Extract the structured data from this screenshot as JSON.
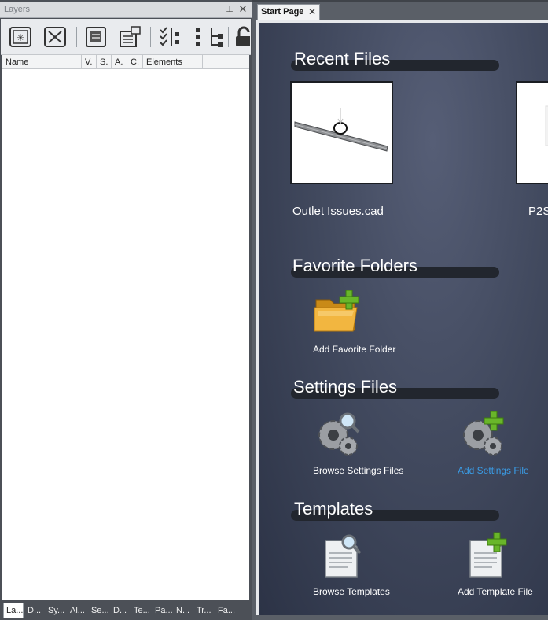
{
  "layers_panel": {
    "title": "Layers",
    "pin_glyph": "⊥",
    "close_glyph": "✕",
    "toolbar_icons": [
      "new-layer-icon",
      "delete-layer-icon",
      "layer-manager-icon",
      "layer-properties-icon",
      "check-tree-icon",
      "expand-tree-icon",
      "collapse-tree-icon",
      "lock-icon"
    ],
    "columns": [
      "Name",
      "V.",
      "S.",
      "A.",
      "C.",
      "Elements"
    ],
    "bottom_tabs": [
      "La...",
      "D...",
      "Sy...",
      "Al...",
      "Se...",
      "D...",
      "Te...",
      "Pa...",
      "N...",
      "Tr...",
      "Fa..."
    ],
    "active_tab_index": 0
  },
  "document": {
    "tab_label": "Start Page",
    "tab_close": "✕"
  },
  "start_page": {
    "recent_files": {
      "heading": "Recent Files",
      "items": [
        {
          "label": "Outlet Issues.cad"
        },
        {
          "label": "P2S"
        }
      ]
    },
    "favorite_folders": {
      "heading": "Favorite Folders",
      "add_label": "Add Favorite Folder"
    },
    "settings_files": {
      "heading": "Settings Files",
      "browse_label": "Browse Settings Files",
      "add_label": "Add Settings File"
    },
    "templates": {
      "heading": "Templates",
      "browse_label": "Browse Templates",
      "add_label": "Add Template File"
    }
  },
  "colors": {
    "panel_bg": "#4c5057",
    "start_page_bg": "#424a5f",
    "link": "#3a9ce6",
    "section_bar": "#22262e"
  }
}
